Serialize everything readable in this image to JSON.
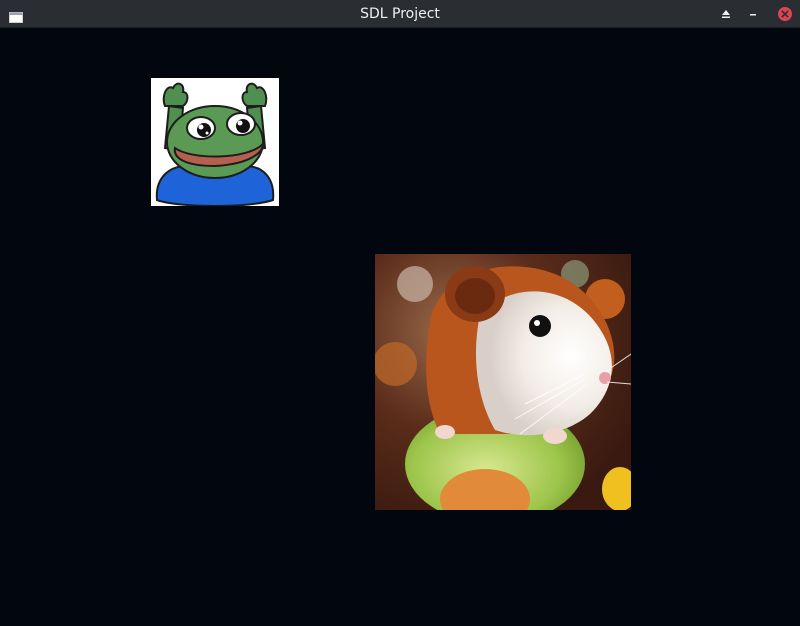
{
  "window": {
    "title": "SDL Project",
    "background_color": "#02060e",
    "titlebar_color": "#2a2e32",
    "app_icon": "window-icon",
    "buttons": [
      {
        "name": "keep-above-button",
        "icon": "eject-icon"
      },
      {
        "name": "minimize-button",
        "icon": "minus-icon"
      },
      {
        "name": "close-button",
        "icon": "close-icon",
        "color": "#da4453"
      }
    ]
  },
  "canvas": {
    "sprites": [
      {
        "name": "frog-sprite",
        "description_icon": "frog-image"
      },
      {
        "name": "hamster-sprite",
        "description_icon": "hamster-image"
      }
    ]
  }
}
